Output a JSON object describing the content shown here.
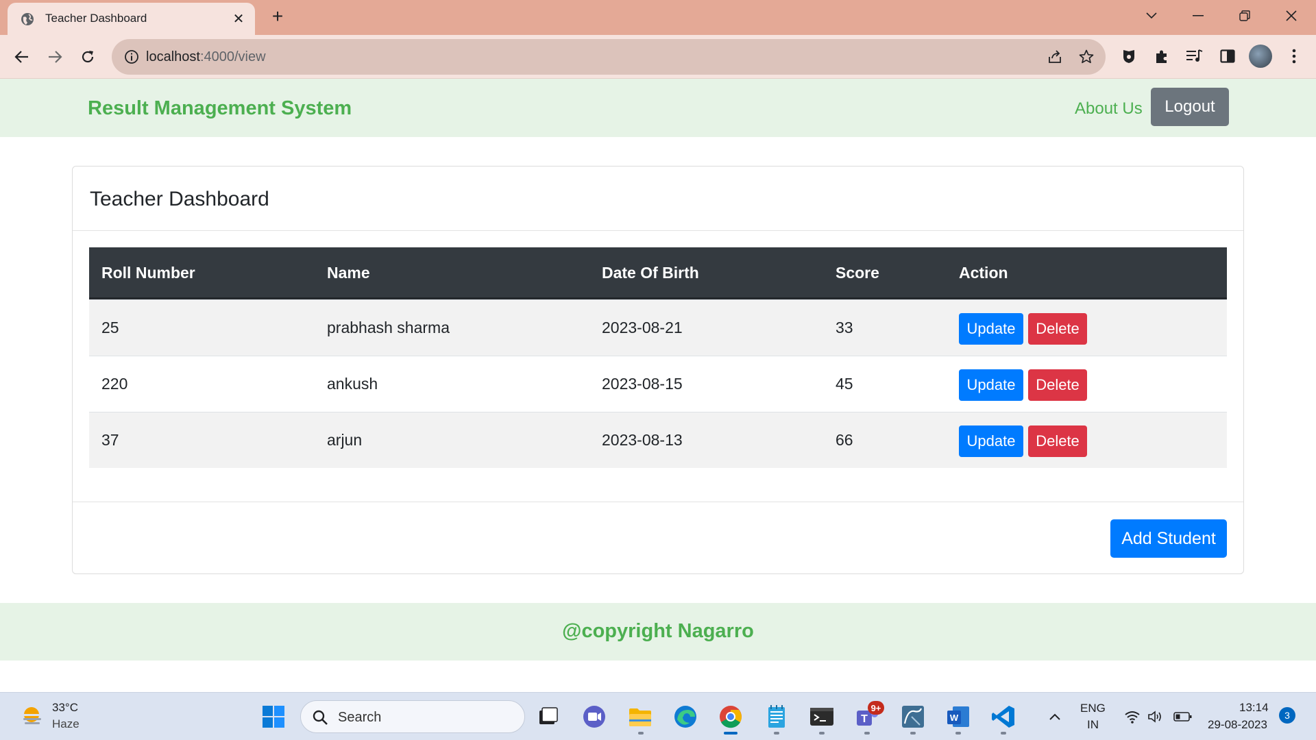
{
  "browser": {
    "tab_title": "Teacher Dashboard",
    "url_host": "localhost",
    "url_path": ":4000/view",
    "new_tab_label": "+",
    "close_label": "✕"
  },
  "navbar": {
    "brand": "Result Management System",
    "about": "About Us",
    "logout": "Logout"
  },
  "dashboard": {
    "title": "Teacher Dashboard",
    "columns": [
      "Roll Number",
      "Name",
      "Date Of Birth",
      "Score",
      "Action"
    ],
    "rows": [
      {
        "roll": "25",
        "name": "prabhash sharma",
        "dob": "2023-08-21",
        "score": "33"
      },
      {
        "roll": "220",
        "name": "ankush",
        "dob": "2023-08-15",
        "score": "45"
      },
      {
        "roll": "37",
        "name": "arjun",
        "dob": "2023-08-13",
        "score": "66"
      }
    ],
    "update_label": "Update",
    "delete_label": "Delete",
    "add_label": "Add Student"
  },
  "footer": {
    "text": "@copyright Nagarro"
  },
  "taskbar": {
    "temperature": "33°C",
    "condition": "Haze",
    "search_placeholder": "Search",
    "teams_badge": "9+",
    "lang_1": "ENG",
    "lang_2": "IN",
    "time": "13:14",
    "date": "29-08-2023",
    "notifications": "3"
  },
  "colors": {
    "brand_green": "#4caf50",
    "primary": "#007bff",
    "danger": "#dc3545",
    "secondary": "#6c757d",
    "table_header": "#343a40",
    "tab_strip": "#e4a996"
  }
}
